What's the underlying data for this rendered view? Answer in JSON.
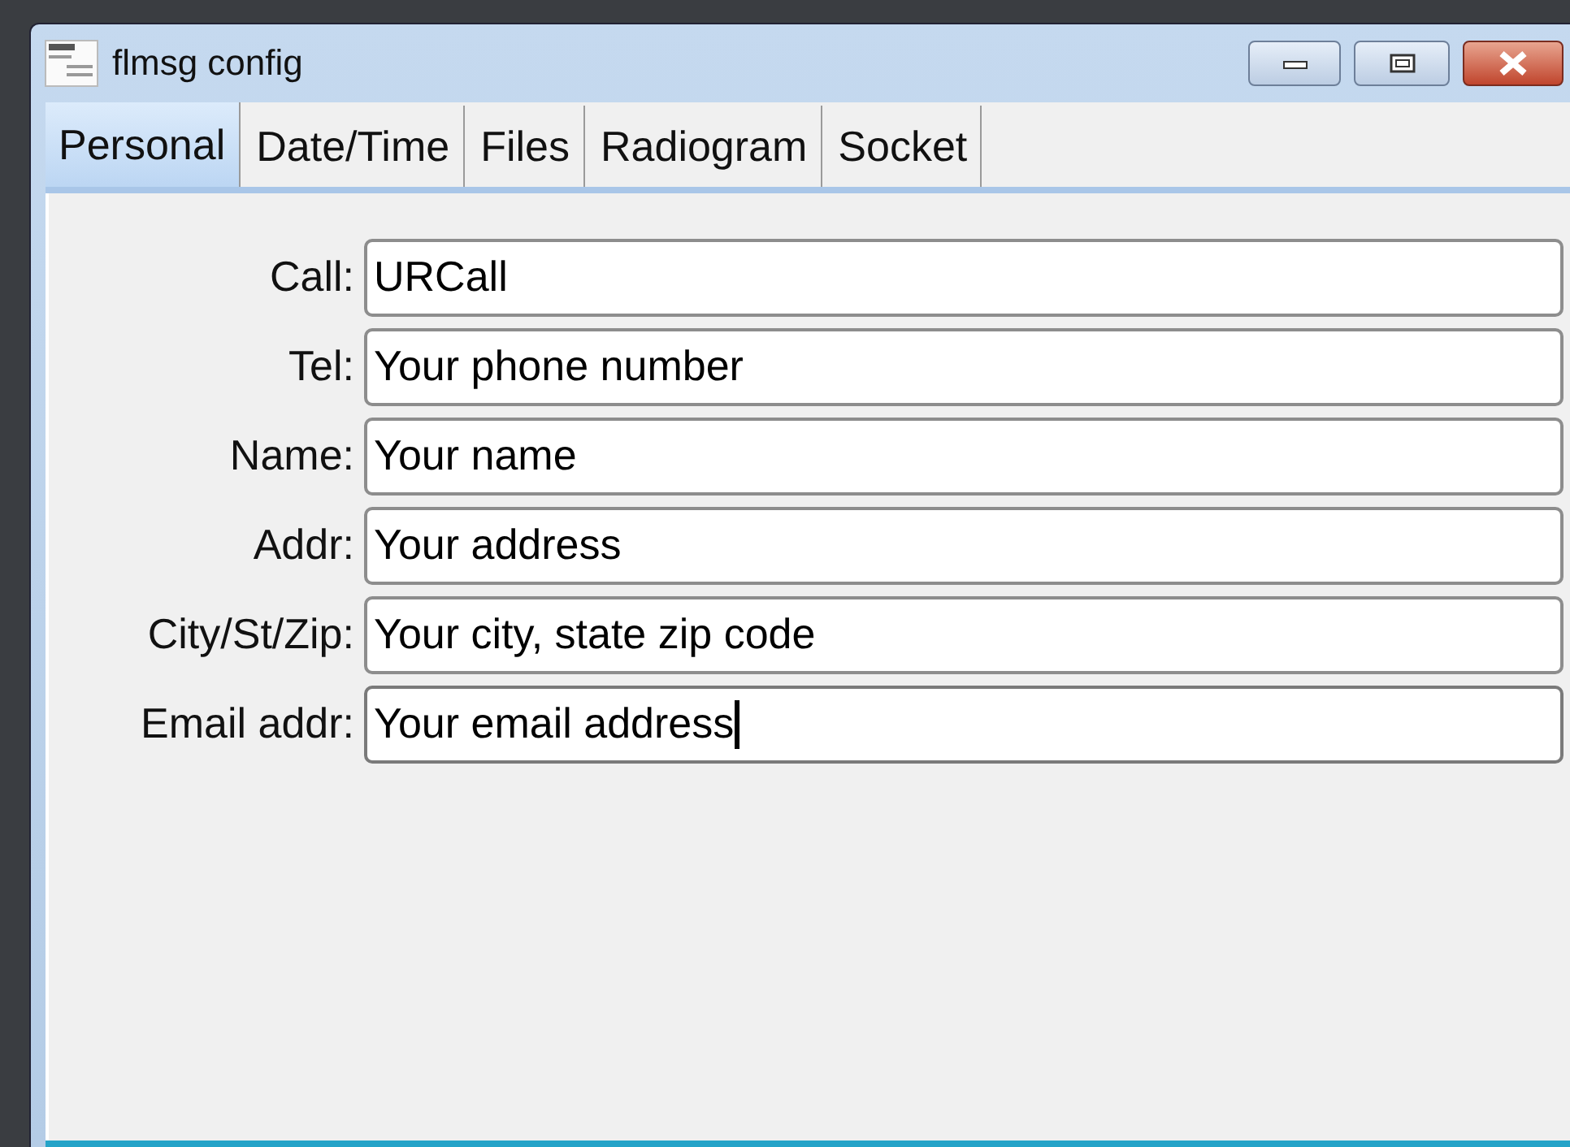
{
  "window": {
    "title": "flmsg config"
  },
  "tabs": [
    {
      "label": "Personal",
      "selected": true
    },
    {
      "label": "Date/Time",
      "selected": false
    },
    {
      "label": "Files",
      "selected": false
    },
    {
      "label": "Radiogram",
      "selected": false
    },
    {
      "label": "Socket",
      "selected": false
    }
  ],
  "fields": [
    {
      "label": "Call:",
      "value": "URCall",
      "focused": false
    },
    {
      "label": "Tel:",
      "value": "Your phone number",
      "focused": false
    },
    {
      "label": "Name:",
      "value": "Your name",
      "focused": false
    },
    {
      "label": "Addr:",
      "value": "Your address",
      "focused": false
    },
    {
      "label": "City/St/Zip:",
      "value": "Your city, state zip code",
      "focused": false
    },
    {
      "label": "Email addr:",
      "value": "Your email address",
      "focused": true
    }
  ]
}
